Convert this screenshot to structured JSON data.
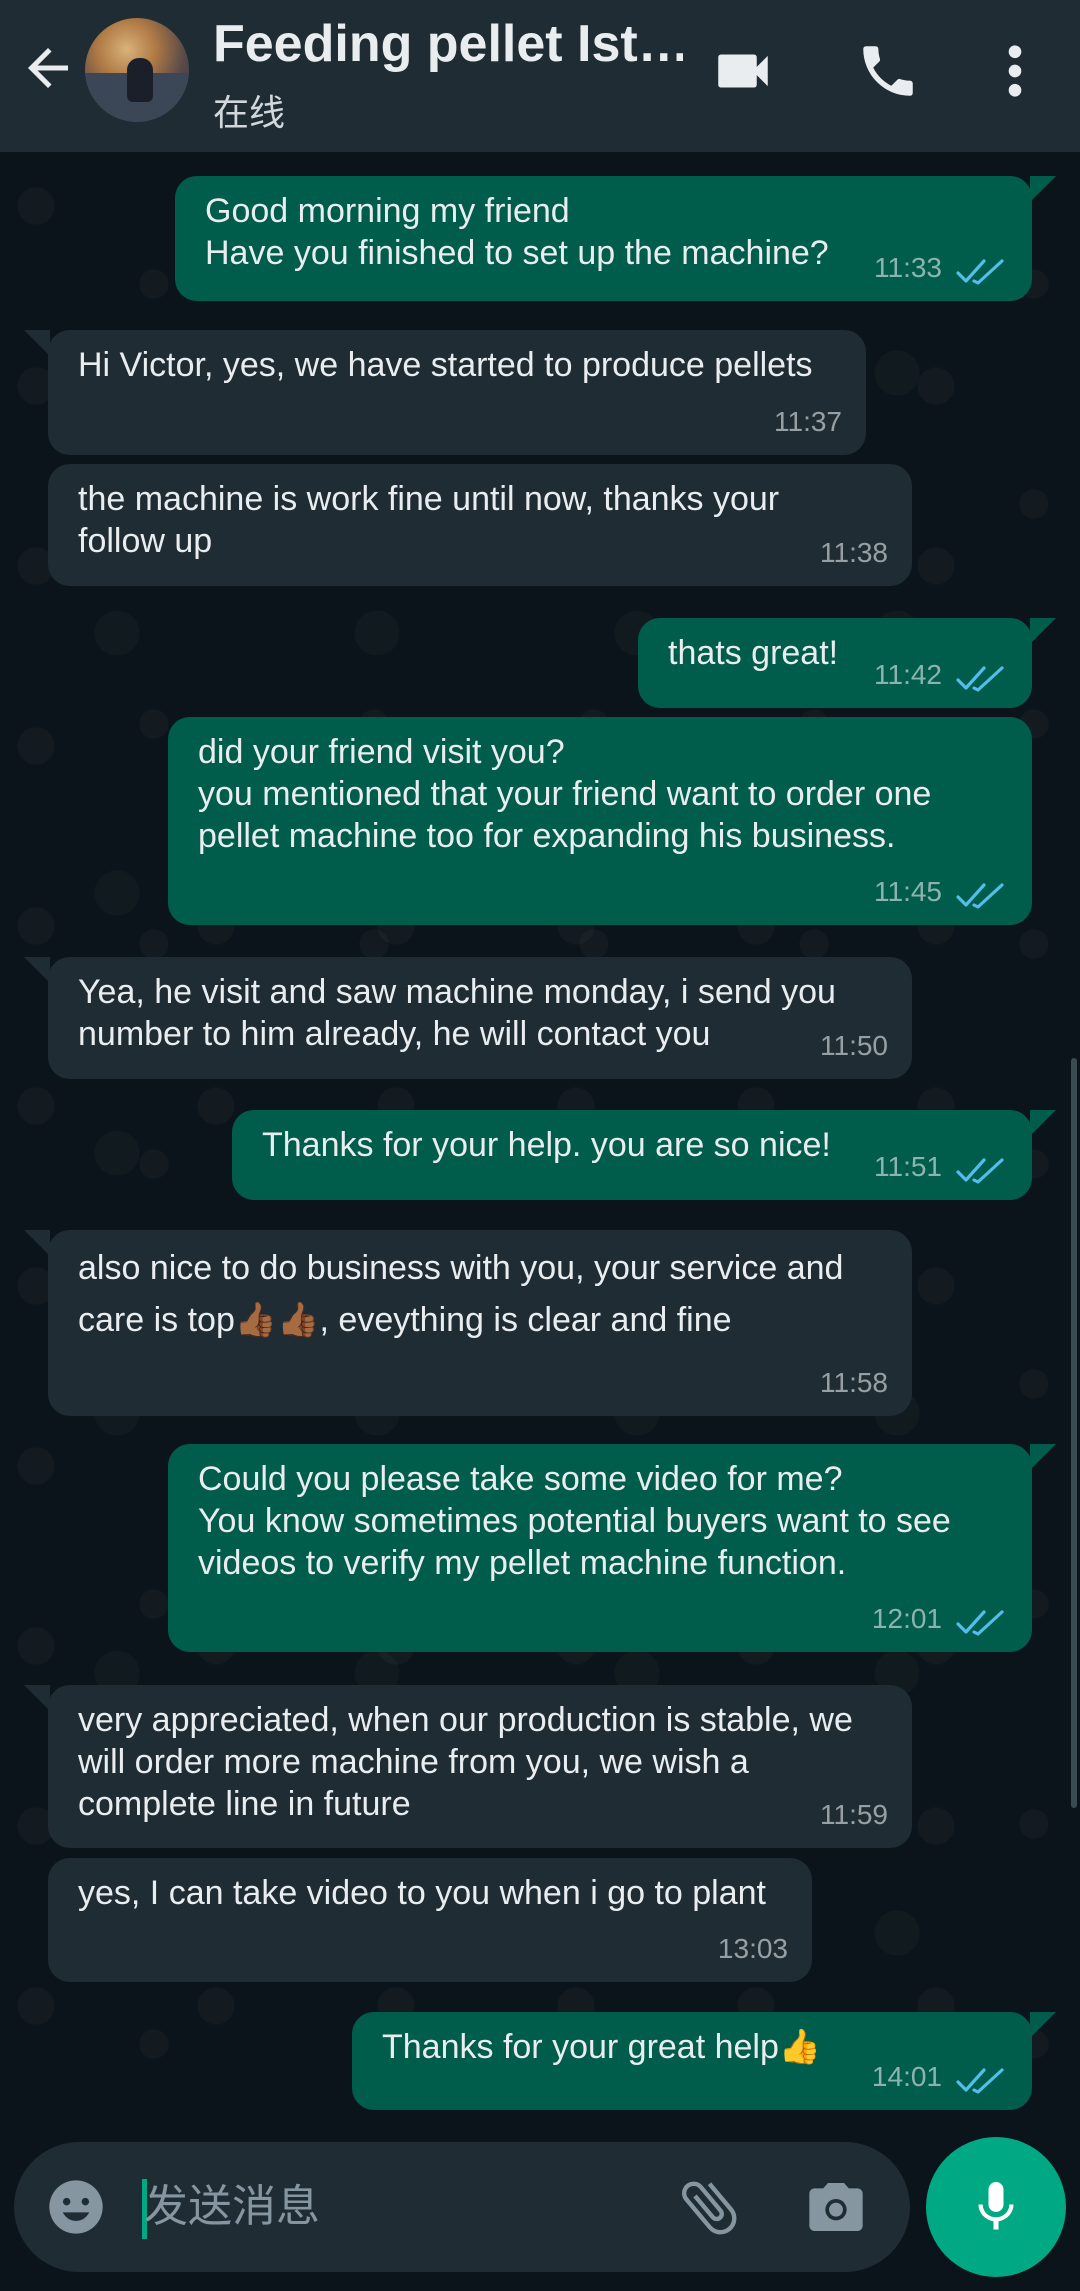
{
  "header": {
    "title": "Feeding pellet Ist…",
    "status": "在线"
  },
  "messages": [
    {
      "dir": "out",
      "text": "Good morning my friend\nHave you finished to set up the machine?",
      "time": "11:33",
      "read": true
    },
    {
      "dir": "in",
      "text": "Hi Victor, yes, we have started to produce pellets",
      "time": "11:37"
    },
    {
      "dir": "in",
      "text": "the machine is work fine until now, thanks your\nfollow up",
      "time": "11:38"
    },
    {
      "dir": "out",
      "text": "thats great!",
      "time": "11:42",
      "read": true
    },
    {
      "dir": "out",
      "text": "did your friend visit you?\nyou mentioned that your friend want to order one\npellet machine too for expanding his business.",
      "time": "11:45",
      "read": true
    },
    {
      "dir": "in",
      "text": "Yea, he visit and saw machine monday, i send you\nnumber to him already, he will contact you",
      "time": "11:50"
    },
    {
      "dir": "out",
      "text": "Thanks for your help. you are so nice!",
      "time": "11:51",
      "read": true
    },
    {
      "dir": "in",
      "text": "also nice to do business with you, your service and\ncare is top👍🏾👍🏾, eveything is clear and fine",
      "time": "11:58"
    },
    {
      "dir": "out",
      "text": "Could you please take some video for me?\nYou know sometimes potential  buyers want to see\nvideos to verify my pellet machine function.",
      "time": "12:01",
      "read": true
    },
    {
      "dir": "in",
      "text": "very appreciated, when our production is stable, we\nwill order more machine from you, we wish a\ncomplete line in future",
      "time": "11:59"
    },
    {
      "dir": "in",
      "text": "yes, I can take video to you when i go to plant",
      "time": "13:03"
    },
    {
      "dir": "out",
      "text": "Thanks for your great help👍",
      "time": "14:01",
      "read": true
    }
  ],
  "input": {
    "placeholder": "发送消息"
  },
  "colors": {
    "background": "#0b141a",
    "header": "#1f2c34",
    "outgoing_bubble": "#005c4b",
    "incoming_bubble": "#1f2c34",
    "accent": "#00a884",
    "read_ticks": "#53bdeb"
  },
  "icons": {
    "back": "arrow-left-icon",
    "video": "video-camera-icon",
    "call": "phone-icon",
    "menu": "more-vert-icon",
    "emoji": "emoji-icon",
    "attach": "paperclip-icon",
    "camera": "camera-icon",
    "mic": "mic-icon",
    "read": "double-check-icon"
  }
}
